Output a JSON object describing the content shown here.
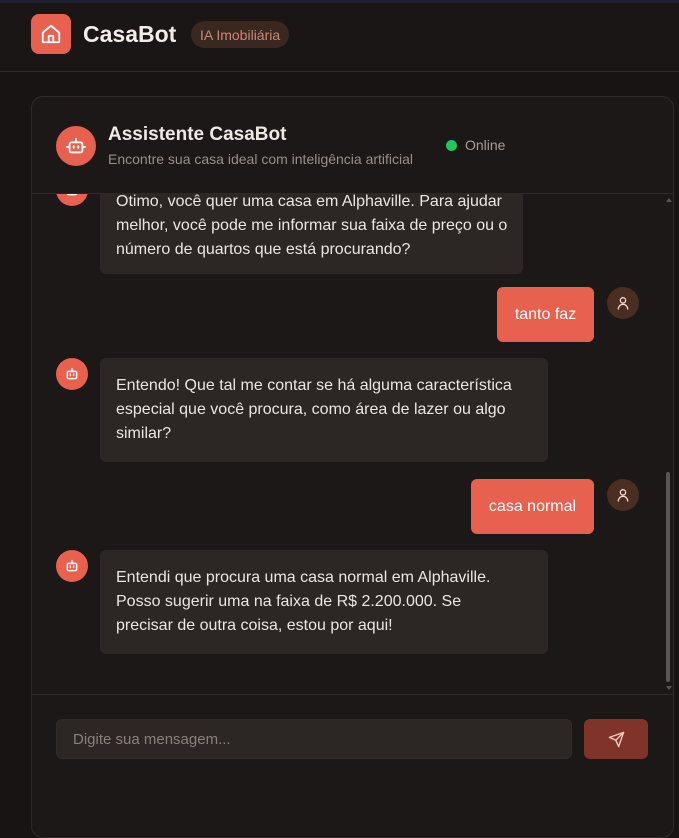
{
  "app": {
    "brand": "CasaBot",
    "badge": "IA Imobiliária"
  },
  "chat": {
    "title": "Assistente CasaBot",
    "subtitle": "Encontre sua casa ideal com inteligência artificial",
    "status": "Online",
    "messages": [
      {
        "role": "bot",
        "lines": [
          "Ótimo, você quer uma casa em Alphaville. Para ajudar",
          "melhor, você pode me informar sua faixa de preço ou o",
          "número de quartos que está procurando?"
        ]
      },
      {
        "role": "user",
        "text": "tanto faz"
      },
      {
        "role": "bot",
        "lines": [
          "Entendo! Que tal me contar se há alguma característica",
          "especial que você procura, como área de lazer ou algo",
          "similar?"
        ]
      },
      {
        "role": "user",
        "text": "casa normal"
      },
      {
        "role": "bot",
        "lines": [
          "Entendi que procura uma casa normal em Alphaville.",
          "Posso sugerir uma na faixa de R$ 2.200.000. Se",
          "precisar de outra coisa, estou por aqui!"
        ]
      }
    ]
  },
  "composer": {
    "placeholder": "Digite sua mensagem...",
    "value": ""
  },
  "icons": {
    "logo": "house-icon",
    "bot": "robot-icon",
    "user": "user-icon",
    "send": "send-icon"
  },
  "colors": {
    "accent": "#e8604e",
    "online": "#22c55e",
    "background": "#171413",
    "bubble_bot": "#2c2624"
  }
}
